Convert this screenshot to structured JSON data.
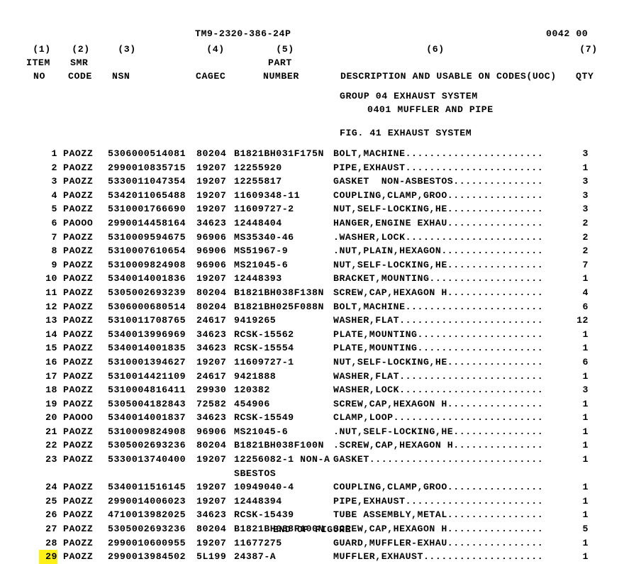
{
  "document": {
    "doc_id": "TM9-2320-386-24P",
    "page_number": "0042 00"
  },
  "column_numbers": {
    "c1": "(1)",
    "c2": "(2)",
    "c3": "(3)",
    "c4": "(4)",
    "c5": "(5)",
    "c6": "(6)",
    "c7": "(7)"
  },
  "column_headers": {
    "line1": {
      "c1": "ITEM",
      "c2": "SMR",
      "c3": "",
      "c4": "",
      "c5": "PART",
      "c6": "",
      "c7": ""
    },
    "line2": {
      "c1": "NO",
      "c2": "CODE",
      "c3": "NSN",
      "c4": "CAGEC",
      "c5": "NUMBER",
      "c6": "DESCRIPTION AND USABLE ON CODES(UOC)",
      "c7": "QTY"
    }
  },
  "titles": {
    "group": "GROUP 04 EXHAUST SYSTEM",
    "subgroup": "0401 MUFFLER AND PIPE",
    "figure": "FIG. 41 EXHAUST SYSTEM"
  },
  "footer": {
    "end_of_figure": "END OF FIGURE"
  },
  "highlight": {
    "color": "#fdf017",
    "item_no": "29"
  },
  "rows": [
    {
      "item": "1",
      "smr": "PAOZZ",
      "nsn": "5306000514081",
      "cagec": "80204",
      "part": "B1821BH031F175N",
      "desc": "BOLT,MACHINE.......................",
      "qty": "3"
    },
    {
      "item": "2",
      "smr": "PAOZZ",
      "nsn": "2990010835715",
      "cagec": "19207",
      "part": "12255920",
      "desc": "PIPE,EXHAUST.......................",
      "qty": "1"
    },
    {
      "item": "3",
      "smr": "PAOZZ",
      "nsn": "5330011047354",
      "cagec": "19207",
      "part": "12255817",
      "desc": "GASKET  NON-ASBESTOS...............",
      "qty": "3"
    },
    {
      "item": "4",
      "smr": "PAOZZ",
      "nsn": "5342011065488",
      "cagec": "19207",
      "part": "11609348-11",
      "desc": "COUPLING,CLAMP,GROO................",
      "qty": "3"
    },
    {
      "item": "5",
      "smr": "PAOZZ",
      "nsn": "5310001766690",
      "cagec": "19207",
      "part": "11609727-2",
      "desc": "NUT,SELF-LOCKING,HE................",
      "qty": "3"
    },
    {
      "item": "6",
      "smr": "PAOOO",
      "nsn": "2990014458164",
      "cagec": "34623",
      "part": "12448404",
      "desc": "HANGER,ENGINE EXHAU................",
      "qty": "2"
    },
    {
      "item": "7",
      "smr": "PAOZZ",
      "nsn": "5310009594675",
      "cagec": "96906",
      "part": "MS35340-46",
      "desc": ".WASHER,LOCK.......................",
      "qty": "2"
    },
    {
      "item": "8",
      "smr": "PAOZZ",
      "nsn": "5310007610654",
      "cagec": "96906",
      "part": "MS51967-9",
      "desc": ".NUT,PLAIN,HEXAGON.................",
      "qty": "2"
    },
    {
      "item": "9",
      "smr": "PAOZZ",
      "nsn": "5310009824908",
      "cagec": "96906",
      "part": "MS21045-6",
      "desc": "NUT,SELF-LOCKING,HE................",
      "qty": "7"
    },
    {
      "item": "10",
      "smr": "PAOZZ",
      "nsn": "5340014001836",
      "cagec": "19207",
      "part": "12448393",
      "desc": "BRACKET,MOUNTING...................",
      "qty": "1"
    },
    {
      "item": "11",
      "smr": "PAOZZ",
      "nsn": "5305002693239",
      "cagec": "80204",
      "part": "B1821BH038F138N",
      "desc": "SCREW,CAP,HEXAGON H................",
      "qty": "4"
    },
    {
      "item": "12",
      "smr": "PAOZZ",
      "nsn": "5306000680514",
      "cagec": "80204",
      "part": "B1821BH025F088N",
      "desc": "BOLT,MACHINE.......................",
      "qty": "6"
    },
    {
      "item": "13",
      "smr": "PAOZZ",
      "nsn": "5310011708765",
      "cagec": "24617",
      "part": "9419265",
      "desc": "WASHER,FLAT........................",
      "qty": "12"
    },
    {
      "item": "14",
      "smr": "PAOZZ",
      "nsn": "5340013996969",
      "cagec": "34623",
      "part": "RCSK-15562",
      "desc": "PLATE,MOUNTING.....................",
      "qty": "1"
    },
    {
      "item": "15",
      "smr": "PAOZZ",
      "nsn": "5340014001835",
      "cagec": "34623",
      "part": "RCSK-15554",
      "desc": "PLATE,MOUNTING.....................",
      "qty": "1"
    },
    {
      "item": "16",
      "smr": "PAOZZ",
      "nsn": "5310001394627",
      "cagec": "19207",
      "part": "11609727-1",
      "desc": "NUT,SELF-LOCKING,HE................",
      "qty": "6"
    },
    {
      "item": "17",
      "smr": "PAOZZ",
      "nsn": "5310014421109",
      "cagec": "24617",
      "part": "9421888",
      "desc": "WASHER,FLAT........................",
      "qty": "1"
    },
    {
      "item": "18",
      "smr": "PAOZZ",
      "nsn": "5310004816411",
      "cagec": "29930",
      "part": "120382",
      "desc": "WASHER,LOCK........................",
      "qty": "3"
    },
    {
      "item": "19",
      "smr": "PAOZZ",
      "nsn": "5305004182843",
      "cagec": "72582",
      "part": "454906",
      "desc": "SCREW,CAP,HEXAGON H................",
      "qty": "1"
    },
    {
      "item": "20",
      "smr": "PAOOO",
      "nsn": "5340014001837",
      "cagec": "34623",
      "part": "RCSK-15549",
      "desc": "CLAMP,LOOP.........................",
      "qty": "1"
    },
    {
      "item": "21",
      "smr": "PAOZZ",
      "nsn": "5310009824908",
      "cagec": "96906",
      "part": "MS21045-6",
      "desc": ".NUT,SELF-LOCKING,HE...............",
      "qty": "1"
    },
    {
      "item": "22",
      "smr": "PAOZZ",
      "nsn": "5305002693236",
      "cagec": "80204",
      "part": "B1821BH038F100N",
      "desc": ".SCREW,CAP,HEXAGON H...............",
      "qty": "1"
    },
    {
      "item": "23",
      "smr": "PAOZZ",
      "nsn": "5330013740400",
      "cagec": "19207",
      "part": "12256082-1 NON-A",
      "desc": "GASKET.............................",
      "qty": "1"
    },
    {
      "item": "",
      "smr": "",
      "nsn": "",
      "cagec": "",
      "part": "SBESTOS",
      "desc": "",
      "qty": "",
      "continuation": true
    },
    {
      "item": "24",
      "smr": "PAOZZ",
      "nsn": "5340011516145",
      "cagec": "19207",
      "part": "10949040-4",
      "desc": "COUPLING,CLAMP,GROO................",
      "qty": "1"
    },
    {
      "item": "25",
      "smr": "PAOZZ",
      "nsn": "2990014006023",
      "cagec": "19207",
      "part": "12448394",
      "desc": "PIPE,EXHAUST.......................",
      "qty": "1"
    },
    {
      "item": "26",
      "smr": "PAOZZ",
      "nsn": "4710013982025",
      "cagec": "34623",
      "part": "RCSK-15439",
      "desc": "TUBE ASSEMBLY,METAL................",
      "qty": "1"
    },
    {
      "item": "27",
      "smr": "PAOZZ",
      "nsn": "5305002693236",
      "cagec": "80204",
      "part": "B1821BH038F100N",
      "desc": "SCREW,CAP,HEXAGON H................",
      "qty": "5"
    },
    {
      "item": "28",
      "smr": "PAOZZ",
      "nsn": "2990010600955",
      "cagec": "19207",
      "part": "11677275",
      "desc": "GUARD,MUFFLER-EXHAU................",
      "qty": "1"
    },
    {
      "item": "29",
      "smr": "PAOZZ",
      "nsn": "2990013984502",
      "cagec": "5L199",
      "part": "24387-A",
      "desc": "MUFFLER,EXHAUST....................",
      "qty": "1",
      "highlighted": true
    }
  ]
}
